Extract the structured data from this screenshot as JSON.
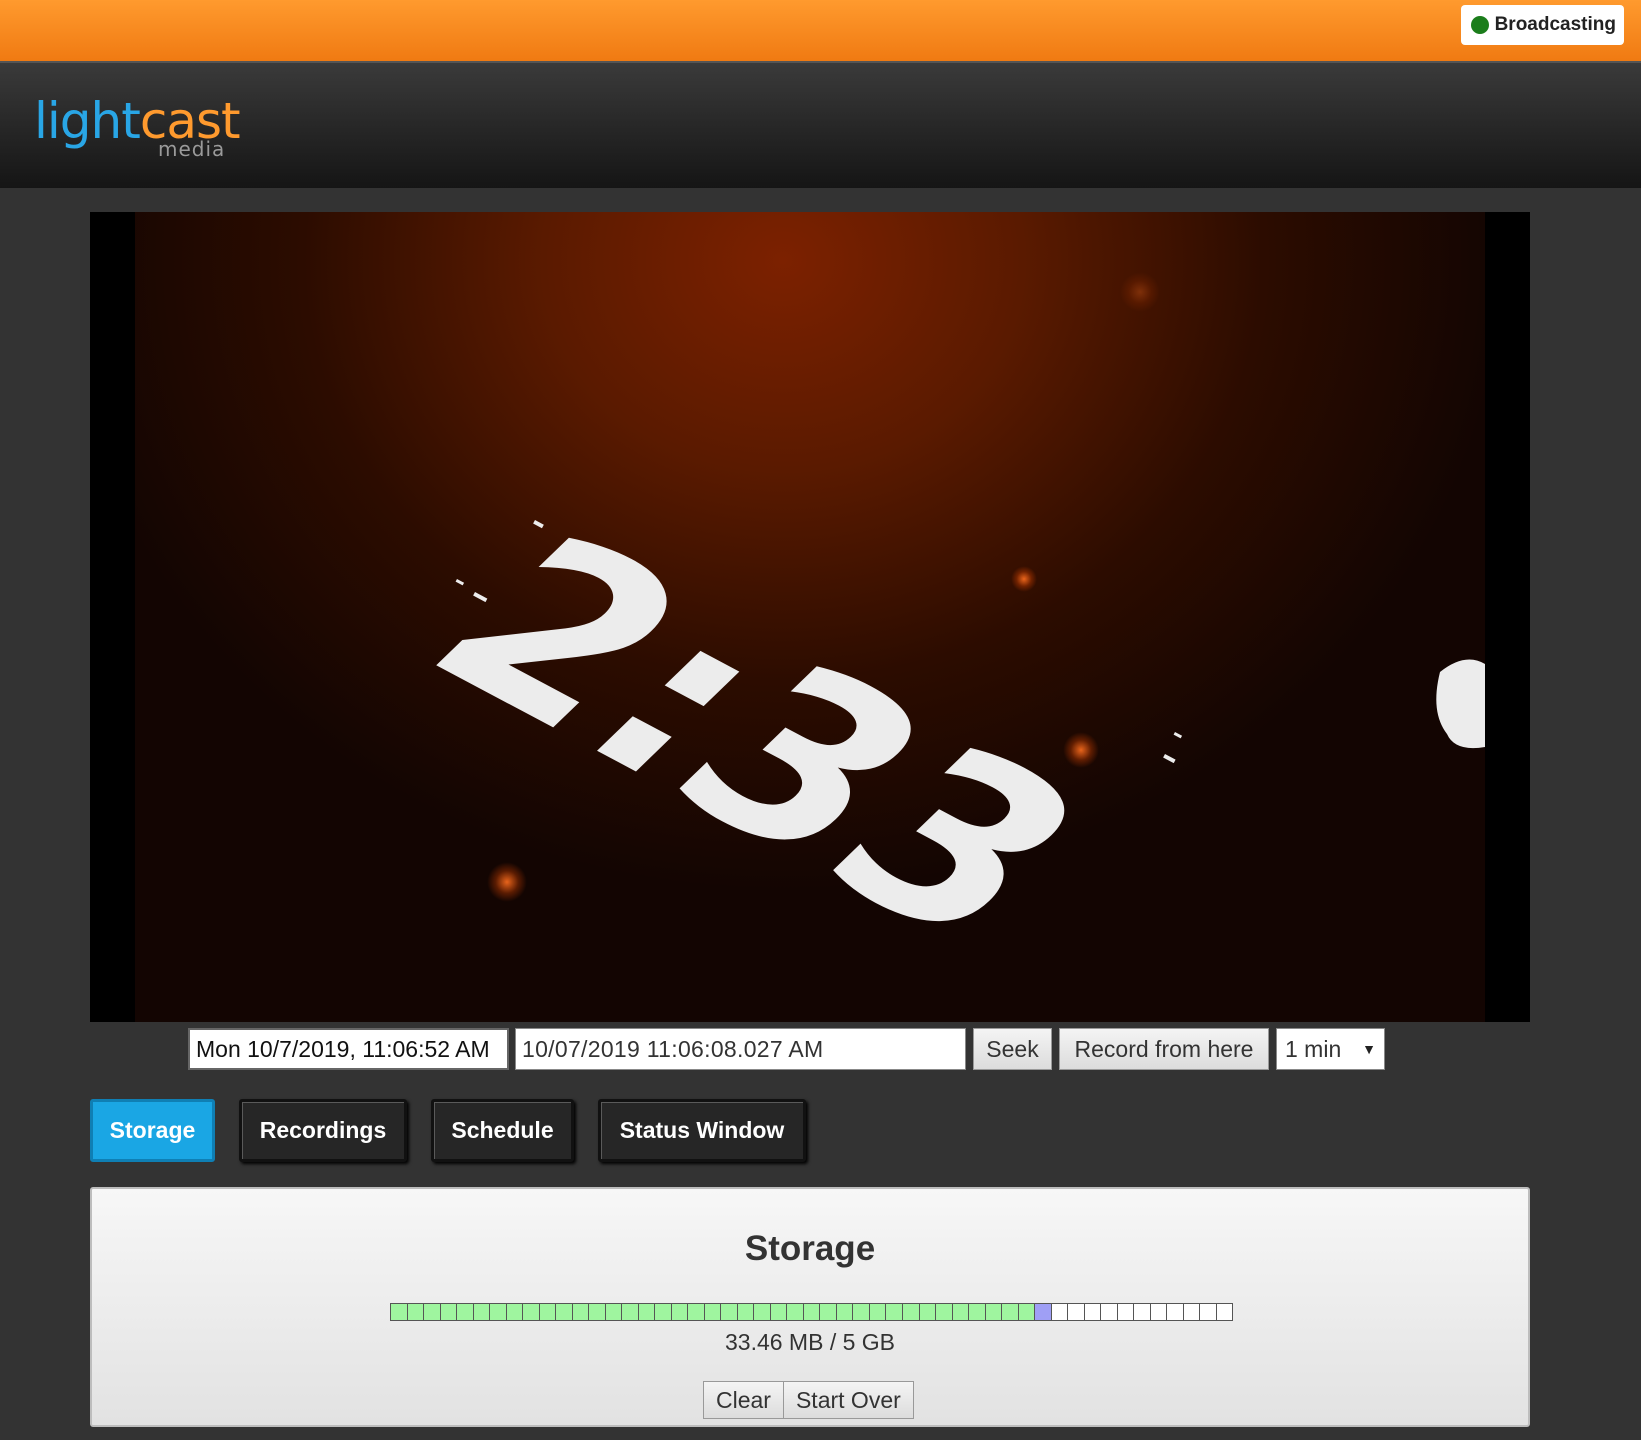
{
  "status": {
    "label": "Broadcasting",
    "dot_color": "#1b7d1b"
  },
  "logo": {
    "part1": "light",
    "part2": "cast",
    "sub": "media"
  },
  "player": {
    "overlay_text": "2:33"
  },
  "controls": {
    "current_time": "Mon 10/7/2019, 11:06:52 AM",
    "seek_time_value": "10/07/2019 11:06:08.027 AM",
    "seek_label": "Seek",
    "record_label": "Record from here",
    "duration_selected": "1 min"
  },
  "tabs": [
    {
      "label": "Storage",
      "active": true
    },
    {
      "label": "Recordings",
      "active": false
    },
    {
      "label": "Schedule",
      "active": false
    },
    {
      "label": "Status Window",
      "active": false
    }
  ],
  "storage": {
    "title": "Storage",
    "usage": "33.46 MB / 5 GB",
    "segments_total": 51,
    "segments_used": 39,
    "segments_current": 1,
    "clear_label": "Clear",
    "start_over_label": "Start Over"
  },
  "colors": {
    "accent": "#1aa6e4",
    "orange": "#f07a12",
    "used": "#9ff59f",
    "current": "#9f9ff5"
  }
}
